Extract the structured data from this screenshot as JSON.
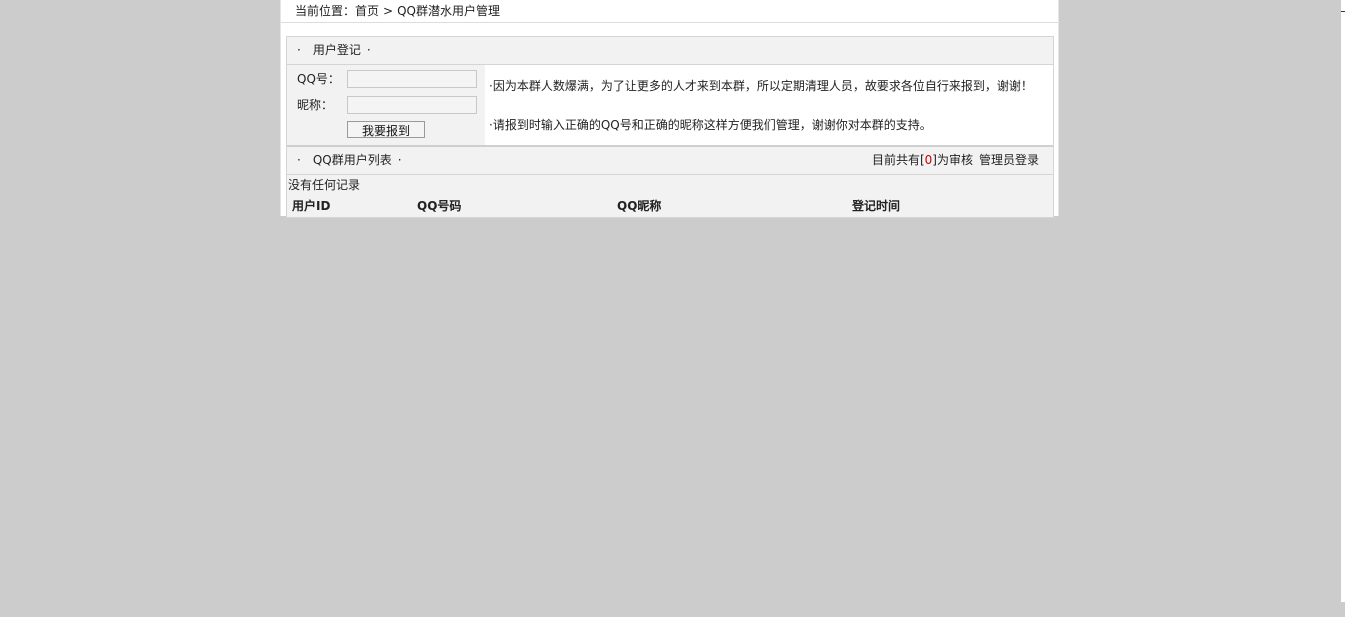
{
  "breadcrumb": {
    "prefix": "当前位置：",
    "home": "首页",
    "separator": ">",
    "current": "QQ群潜水用户管理"
  },
  "register": {
    "title_dot_left": "·",
    "title": "用户登记",
    "title_dot_right": "·",
    "qq_label": "QQ号：",
    "qq_value": "",
    "nickname_label": "昵称：",
    "nickname_value": "",
    "submit_label": "我要报到",
    "note1": "·因为本群人数爆满，为了让更多的人才来到本群，所以定期清理人员，故要求各位自行来报到，谢谢！",
    "note2": "·请报到时输入正确的QQ号和正确的昵称这样方便我们管理，谢谢你对本群的支持。"
  },
  "list": {
    "title_dot_left": "·",
    "title": "QQ群用户列表",
    "title_dot_right": "·",
    "count_prefix": "目前共有[",
    "count_value": "0",
    "count_suffix": "]为审核",
    "admin_login": "管理员登录",
    "empty_text": "没有任何记录",
    "columns": [
      "用户ID",
      "QQ号码",
      "QQ昵称",
      "登记时间"
    ]
  }
}
